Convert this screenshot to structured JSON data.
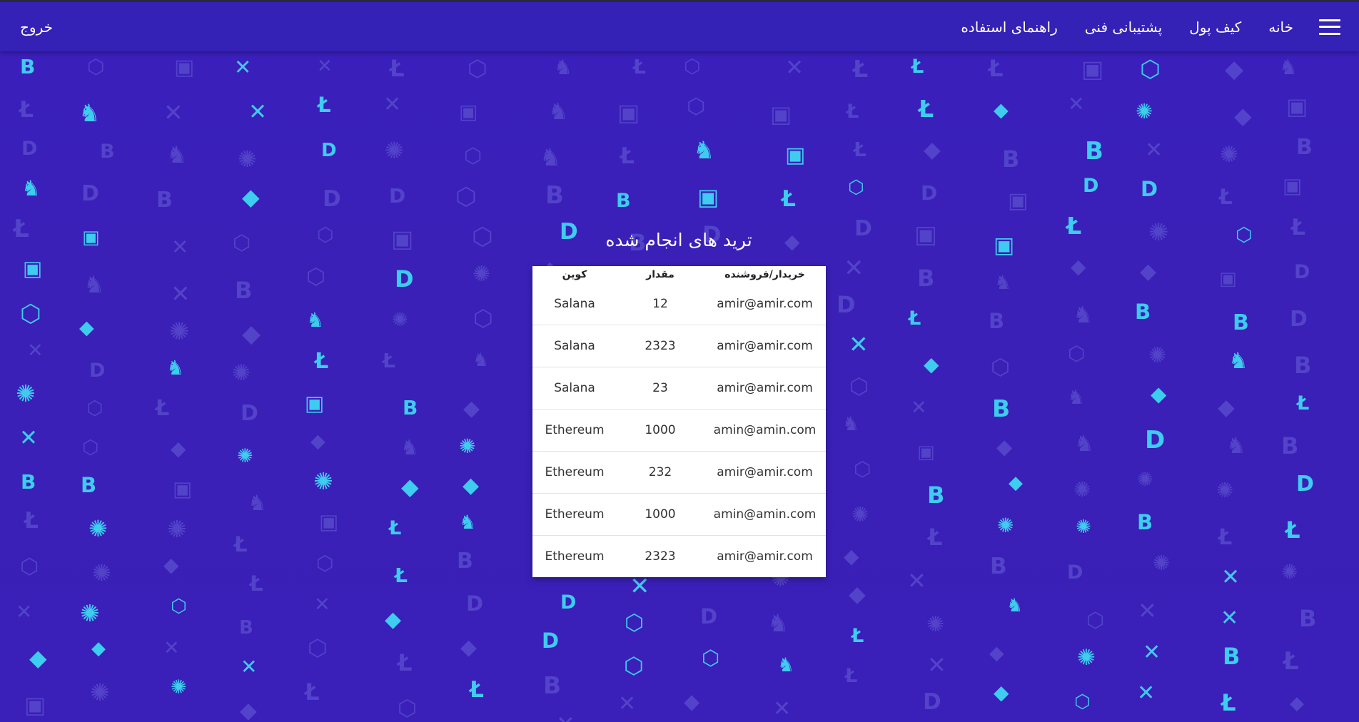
{
  "navbar": {
    "menu_icon": "hamburger-menu-icon",
    "links": [
      "خانه",
      "کیف پول",
      "پشتیبانی فنی",
      "راهنمای استفاده"
    ],
    "logout_label": "خروج"
  },
  "main": {
    "title": "ترید های انجام شده",
    "table": {
      "headers": {
        "user": "خریدار/فروشنده",
        "amount": "مقدار",
        "coin": "کوین"
      },
      "rows": [
        {
          "user": "amir@amir.com",
          "amount": "12",
          "coin": "Salana"
        },
        {
          "user": "amir@amir.com",
          "amount": "2323",
          "coin": "Salana"
        },
        {
          "user": "amir@amir.com",
          "amount": "23",
          "coin": "Salana"
        },
        {
          "user": "amin@amin.com",
          "amount": "1000",
          "coin": "Ethereum"
        },
        {
          "user": "amir@amir.com",
          "amount": "232",
          "coin": "Ethereum"
        },
        {
          "user": "amin@amin.com",
          "amount": "1000",
          "coin": "Ethereum"
        },
        {
          "user": "amir@amir.com",
          "amount": "2323",
          "coin": "Ethereum"
        }
      ]
    }
  },
  "colors": {
    "background": "#3a1fb8",
    "navbar": "#3421b5",
    "accent_cyan": "#3fd6f2",
    "pattern_dim": "#5a4fd0"
  },
  "background_icons": [
    "litecoin-icon",
    "ethereum-icon",
    "polygon-icon",
    "cardano-icon",
    "xrp-icon",
    "bitcoin-icon",
    "uniswap-icon",
    "dash-icon",
    "tether-icon"
  ]
}
